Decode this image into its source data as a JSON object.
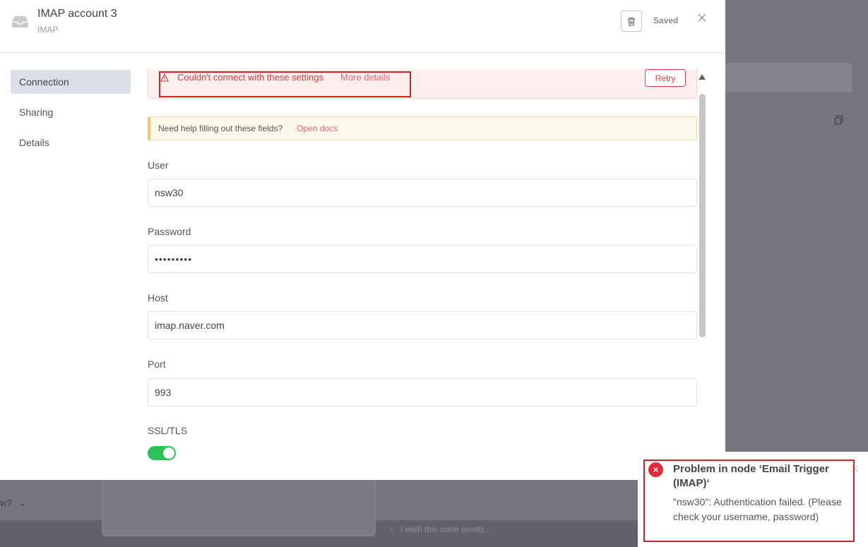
{
  "background": {
    "left_fragment": "w?",
    "wish_text": "I wish this node would..."
  },
  "modal": {
    "title": "IMAP account 3",
    "subtitle": "IMAP",
    "saved_label": "Saved",
    "sidebar": {
      "items": [
        {
          "label": "Connection",
          "active": true
        },
        {
          "label": "Sharing",
          "active": false
        },
        {
          "label": "Details",
          "active": false
        }
      ]
    },
    "error_banner": {
      "text": "Couldn't connect with these settings",
      "link": "More details",
      "retry_label": "Retry"
    },
    "help": {
      "text": "Need help filling out these fields?",
      "link": "Open docs"
    },
    "fields": {
      "user": {
        "label": "User",
        "value": "nsw30"
      },
      "password": {
        "label": "Password",
        "value": "•••••••••"
      },
      "host": {
        "label": "Host",
        "value": "imap.naver.com"
      },
      "port": {
        "label": "Port",
        "value": "993"
      },
      "ssl": {
        "label": "SSL/TLS",
        "enabled": true
      }
    }
  },
  "toast": {
    "title": "Problem in node ‘Email Trigger (IMAP)‘",
    "message": "\"nsw30\": Authentication failed. (Please check your username, password)"
  },
  "colors": {
    "error": "#e32a3c",
    "link": "#f0626e",
    "toggle_on": "#29c458",
    "highlight": "#dc1f1f"
  }
}
